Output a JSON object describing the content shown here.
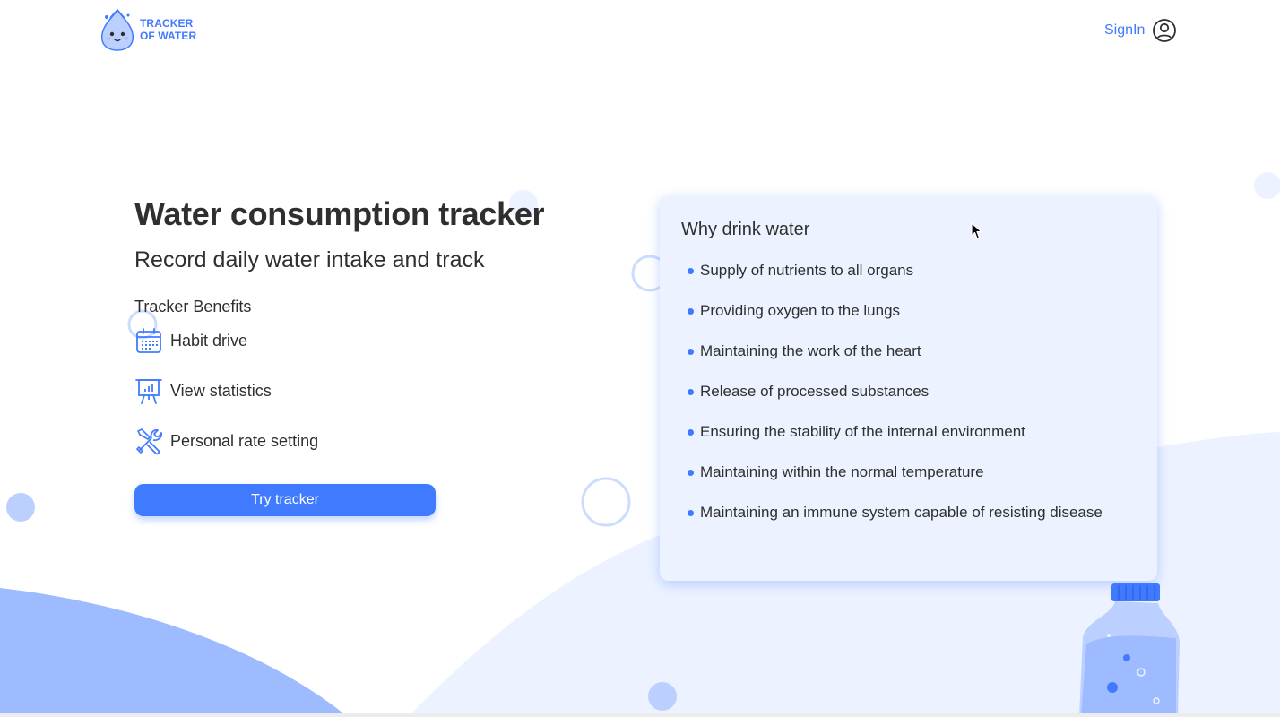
{
  "header": {
    "logo_line1": "TRACKER",
    "logo_line2": "OF WATER",
    "signin_label": "SignIn",
    "logo_icon": "water-drop-mascot-icon",
    "user_icon": "user-circle-icon"
  },
  "hero": {
    "title": "Water consumption tracker",
    "subtitle": "Record daily water intake and track",
    "benefits_title": "Tracker Benefits",
    "benefits": [
      {
        "label": "Habit drive",
        "icon": "calendar-icon"
      },
      {
        "label": "View statistics",
        "icon": "presentation-chart-icon"
      },
      {
        "label": "Personal rate setting",
        "icon": "tools-icon"
      }
    ],
    "cta_label": "Try tracker"
  },
  "why_card": {
    "title": "Why drink water",
    "items": [
      "Supply of nutrients to all organs",
      "Providing oxygen to the lungs",
      "Maintaining the work of the heart",
      "Release of processed substances",
      "Ensuring the stability of the internal environment",
      "Maintaining within the normal temperature",
      "Maintaining an immune system capable of resisting disease"
    ]
  },
  "colors": {
    "accent": "#407bff",
    "text": "#2f2f2f",
    "card_bg": "#ecf2ff",
    "wave_dark": "#9ebbff",
    "wave_light": "#ecf2ff"
  }
}
